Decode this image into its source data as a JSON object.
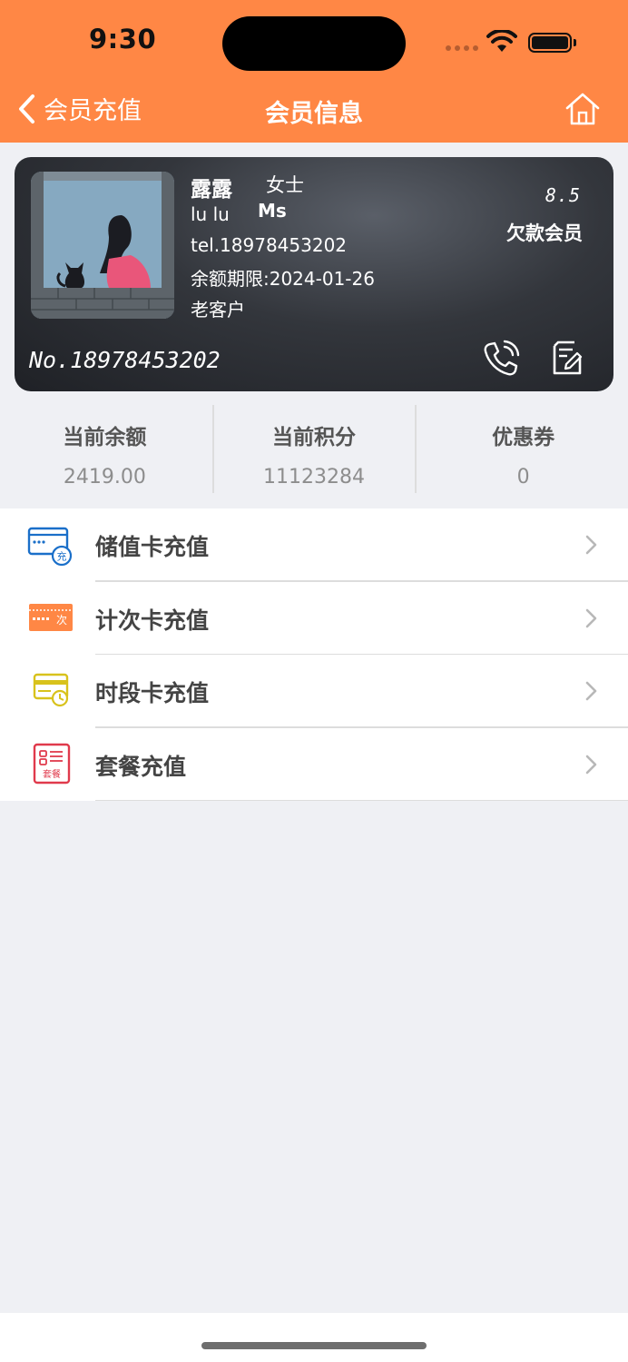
{
  "status_bar": {
    "time": "9:30"
  },
  "nav": {
    "back_label": "会员充值",
    "title": "会员信息"
  },
  "member": {
    "name": "露露",
    "gender": "女士",
    "english_name": "lu lu",
    "title_en": "Ms",
    "phone": "tel.18978453202",
    "expiry": "余额期限:2024-01-26",
    "tag": "老客户",
    "discount": "8.5",
    "level": "欠款会员",
    "card_no": "No.18978453202"
  },
  "stats": [
    {
      "label": "当前余额",
      "value": "2419.00"
    },
    {
      "label": "当前积分",
      "value": "11123284"
    },
    {
      "label": "优惠券",
      "value": "0"
    }
  ],
  "menu": [
    {
      "label": "储值卡充值",
      "icon": "stored-value-card-icon",
      "icon_text": "充",
      "color": "#1a6fc9"
    },
    {
      "label": "计次卡充值",
      "icon": "count-card-icon",
      "icon_text": "次",
      "color": "#ff8745"
    },
    {
      "label": "时段卡充值",
      "icon": "period-card-icon",
      "icon_text": "",
      "color": "#d8c21c"
    },
    {
      "label": "套餐充值",
      "icon": "package-icon",
      "icon_text": "套餐",
      "color": "#e03a4c"
    }
  ],
  "colors": {
    "nav_bg": "#ff8745",
    "page_bg": "#eff0f4"
  }
}
